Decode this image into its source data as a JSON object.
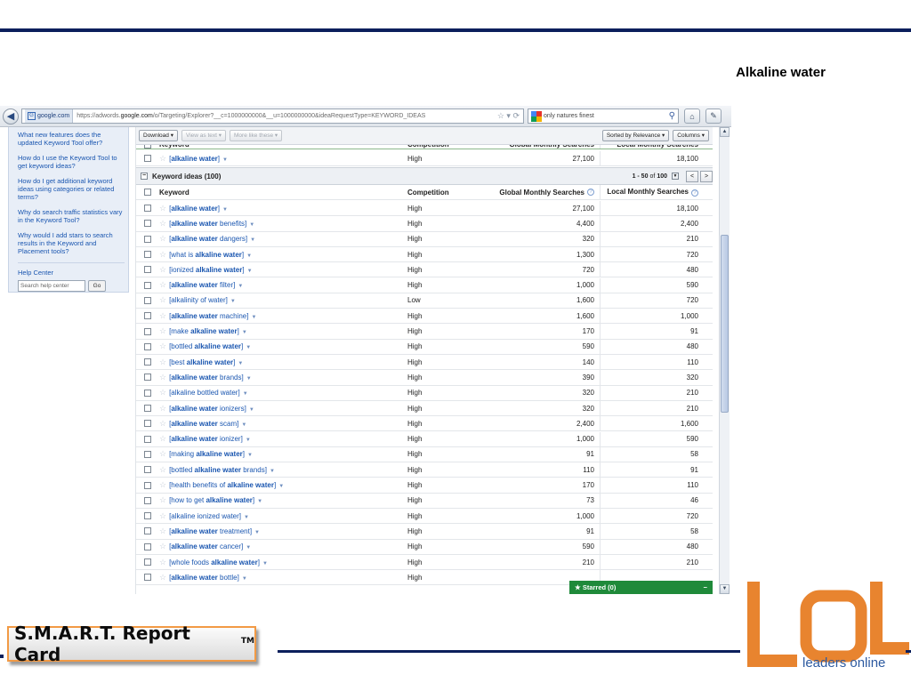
{
  "slide": {
    "title": "Alkaline water",
    "report_card": "S.M.A.R.T. Report Card",
    "report_card_tm": "TM",
    "logo_letters": "LOL",
    "logo_tagline": "leaders online",
    "accent": "#0b1f5c",
    "logo_color": "#e8842f"
  },
  "browser": {
    "back_icon": "back-arrow-icon",
    "site": "google.com",
    "url_prefix": "https://adwords.",
    "url_domain": "google.com",
    "url_rest": "/o/Targeting/Explorer?__c=1000000000&__u=1000000000&ideaRequestType=KEYWORD_IDEAS",
    "search_text": "only natures finest"
  },
  "sidebar": {
    "links": [
      "What new features does the updated Keyword Tool offer?",
      "How do I use the Keyword Tool to get keyword ideas?",
      "How do I get additional keyword ideas using categories or related terms?",
      "Why do search traffic statistics vary in the Keyword Tool?",
      "Why would I add stars to search results in the Keyword and Placement tools?"
    ],
    "help_center": "Help Center",
    "search_placeholder": "Search help center",
    "go": "Go"
  },
  "toolbar": {
    "download": "Download",
    "view_as_text": "View as text",
    "more_like_these": "More like these",
    "sorted_by": "Sorted by Relevance",
    "columns": "Columns"
  },
  "columns": {
    "keyword": "Keyword",
    "competition": "Competition",
    "global": "Global Monthly Searches",
    "local": "Local Monthly Searches"
  },
  "search_terms_row": {
    "pre": "[",
    "bold": "alkaline water",
    "post": "]",
    "competition": "High",
    "global": "27,100",
    "local": "18,100"
  },
  "ideas": {
    "section_label": "Keyword ideas (100)",
    "range": "1 - 50",
    "of": "of",
    "total": "100",
    "prev": "<",
    "next": ">",
    "rows": [
      {
        "pre": "[",
        "bold": "alkaline water",
        "post": "]",
        "competition": "High",
        "global": "27,100",
        "local": "18,100"
      },
      {
        "pre": "[",
        "bold": "alkaline water",
        "post": " benefits]",
        "competition": "High",
        "global": "4,400",
        "local": "2,400"
      },
      {
        "pre": "[",
        "bold": "alkaline water",
        "post": " dangers]",
        "competition": "High",
        "global": "320",
        "local": "210"
      },
      {
        "pre": "[what is ",
        "bold": "alkaline water",
        "post": "]",
        "competition": "High",
        "global": "1,300",
        "local": "720"
      },
      {
        "pre": "[ionized ",
        "bold": "alkaline water",
        "post": "]",
        "competition": "High",
        "global": "720",
        "local": "480"
      },
      {
        "pre": "[",
        "bold": "alkaline water",
        "post": " filter]",
        "competition": "High",
        "global": "1,000",
        "local": "590"
      },
      {
        "pre": "[alkalinity of water]",
        "bold": "",
        "post": "",
        "competition": "Low",
        "global": "1,600",
        "local": "720"
      },
      {
        "pre": "[",
        "bold": "alkaline water",
        "post": " machine]",
        "competition": "High",
        "global": "1,600",
        "local": "1,000"
      },
      {
        "pre": "[make ",
        "bold": "alkaline water",
        "post": "]",
        "competition": "High",
        "global": "170",
        "local": "91"
      },
      {
        "pre": "[bottled ",
        "bold": "alkaline water",
        "post": "]",
        "competition": "High",
        "global": "590",
        "local": "480"
      },
      {
        "pre": "[best ",
        "bold": "alkaline water",
        "post": "]",
        "competition": "High",
        "global": "140",
        "local": "110"
      },
      {
        "pre": "[",
        "bold": "alkaline water",
        "post": " brands]",
        "competition": "High",
        "global": "390",
        "local": "320"
      },
      {
        "pre": "[alkaline bottled water]",
        "bold": "",
        "post": "",
        "competition": "High",
        "global": "320",
        "local": "210"
      },
      {
        "pre": "[",
        "bold": "alkaline water",
        "post": " ionizers]",
        "competition": "High",
        "global": "320",
        "local": "210"
      },
      {
        "pre": "[",
        "bold": "alkaline water",
        "post": " scam]",
        "competition": "High",
        "global": "2,400",
        "local": "1,600"
      },
      {
        "pre": "[",
        "bold": "alkaline water",
        "post": " ionizer]",
        "competition": "High",
        "global": "1,000",
        "local": "590"
      },
      {
        "pre": "[making ",
        "bold": "alkaline water",
        "post": "]",
        "competition": "High",
        "global": "91",
        "local": "58"
      },
      {
        "pre": "[bottled ",
        "bold": "alkaline water",
        "post": " brands]",
        "competition": "High",
        "global": "110",
        "local": "91"
      },
      {
        "pre": "[health benefits of ",
        "bold": "alkaline water",
        "post": "]",
        "competition": "High",
        "global": "170",
        "local": "110"
      },
      {
        "pre": "[how to get ",
        "bold": "alkaline water",
        "post": "]",
        "competition": "High",
        "global": "73",
        "local": "46"
      },
      {
        "pre": "[alkaline ionized water]",
        "bold": "",
        "post": "",
        "competition": "High",
        "global": "1,000",
        "local": "720"
      },
      {
        "pre": "[",
        "bold": "alkaline water",
        "post": " treatment]",
        "competition": "High",
        "global": "91",
        "local": "58"
      },
      {
        "pre": "[",
        "bold": "alkaline water",
        "post": " cancer]",
        "competition": "High",
        "global": "590",
        "local": "480"
      },
      {
        "pre": "[whole foods ",
        "bold": "alkaline water",
        "post": "]",
        "competition": "High",
        "global": "210",
        "local": "210"
      },
      {
        "pre": "[",
        "bold": "alkaline water",
        "post": " bottle]",
        "competition": "High",
        "global": "",
        "local": ""
      }
    ]
  },
  "starred": {
    "label": "Starred (0)",
    "collapse": "−"
  }
}
